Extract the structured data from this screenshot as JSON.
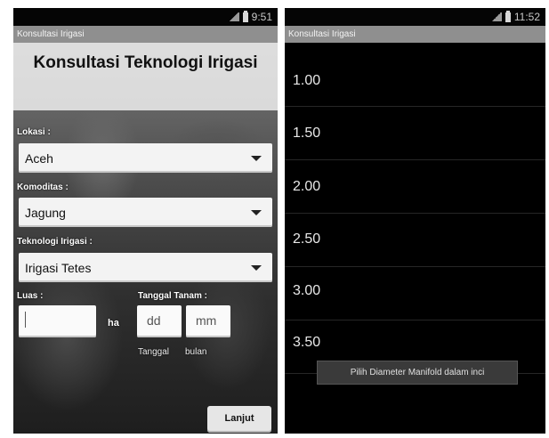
{
  "left_screen": {
    "status_time": "9:51",
    "title_bar": "Konsultasi Irigasi",
    "heading": "Konsultasi Teknologi Irigasi",
    "lokasi": {
      "label": "Lokasi :",
      "value": "Aceh"
    },
    "komoditas": {
      "label": "Komoditas :",
      "value": "Jagung"
    },
    "teknologi": {
      "label": "Teknologi Irigasi :",
      "value": "Irigasi Tetes"
    },
    "luas": {
      "label": "Luas :",
      "value": "",
      "unit": "ha"
    },
    "tanggal_tanam": {
      "label": "Tanggal Tanam :",
      "day_placeholder": "dd",
      "month_placeholder": "mm",
      "day_label": "Tanggal",
      "month_label": "bulan"
    },
    "next_button": "Lanjut"
  },
  "right_screen": {
    "status_time": "11:52",
    "title_bar": "Konsultasi Irigasi",
    "items": [
      "1.00",
      "1.50",
      "2.00",
      "2.50",
      "3.00",
      "3.50"
    ],
    "toast": "Pilih Diameter Manifold dalam inci"
  }
}
